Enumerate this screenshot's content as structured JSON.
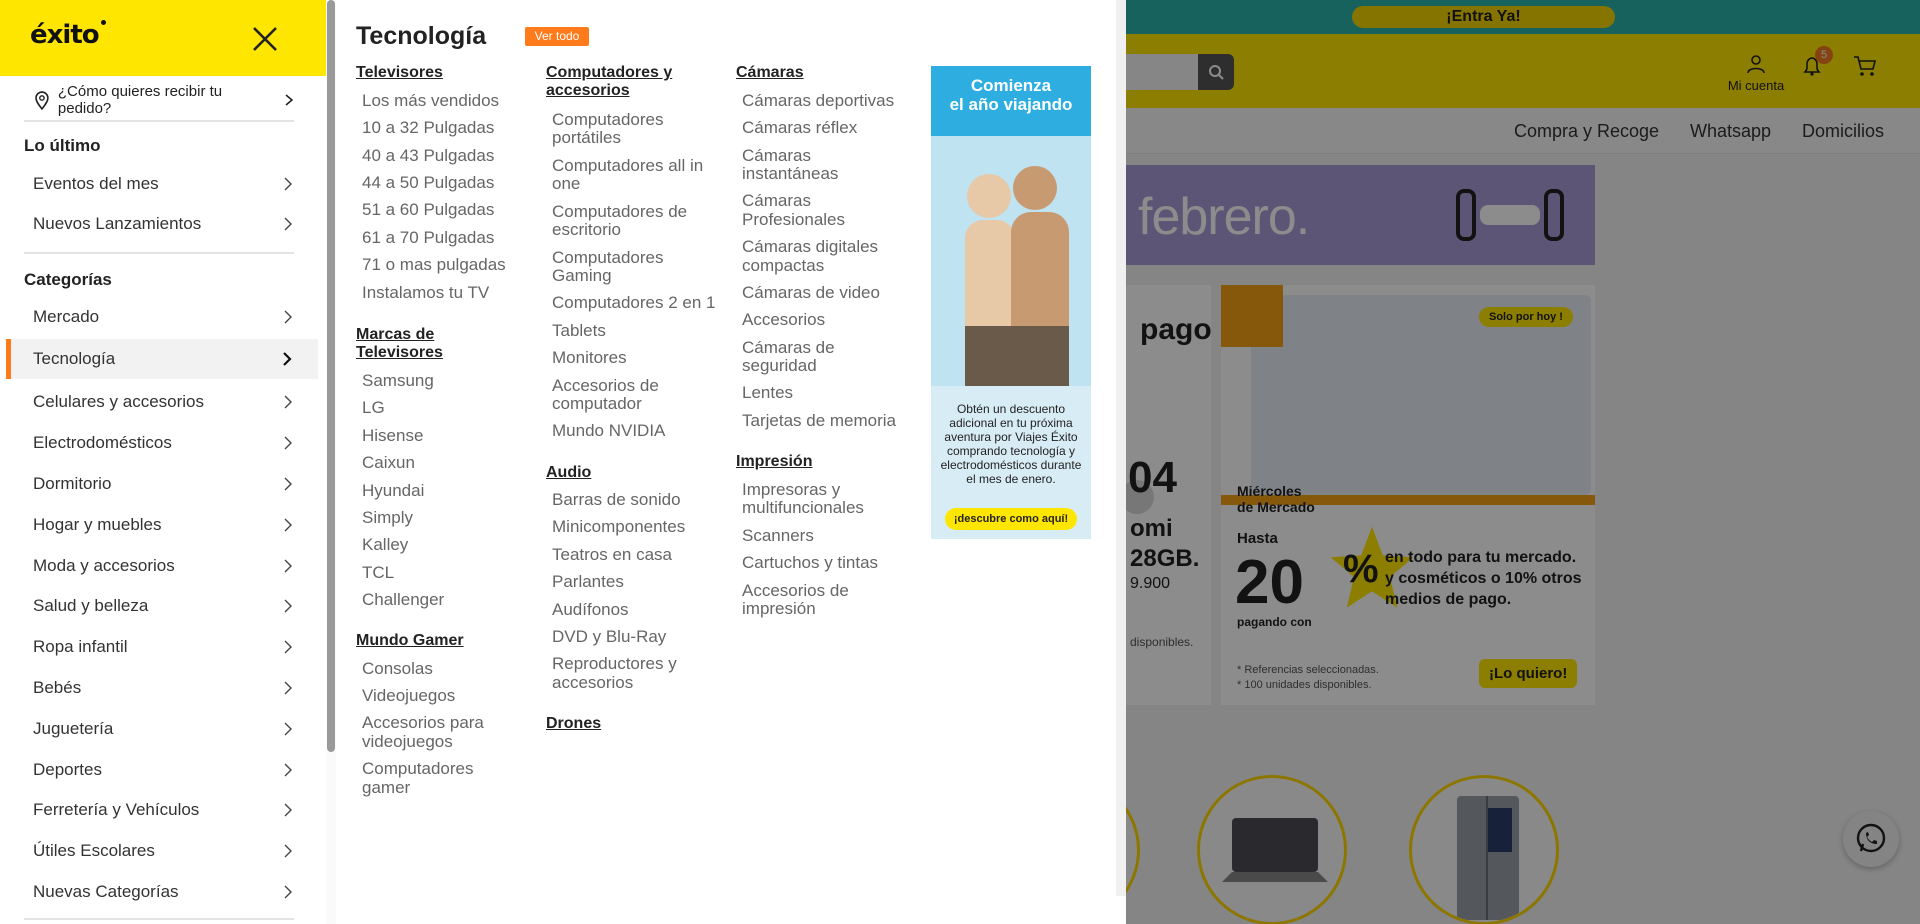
{
  "page": {
    "promo_button": "¡Entra Ya!",
    "account_label": "Mi cuenta",
    "notifications_count": "5",
    "nav_links": [
      "Compra y Recoge",
      "Whatsapp",
      "Domicilios"
    ],
    "banner_text": "febrero.",
    "card_left": {
      "title_fragment": "pago",
      "big_fragment": "04",
      "product_fragment": "omi",
      "storage_fragment": "28GB.",
      "price_fragment": "9.900",
      "note_fragment": "disponibles."
    },
    "card_right": {
      "badge": "Solo por hoy !",
      "title_line1": "Miércoles",
      "title_line2": "de Mercado",
      "hasta": "Hasta",
      "discount": "20",
      "percent": "%",
      "description": "en todo para tu mercado. y cosméticos o 10% otros medios de pago.",
      "pagando": "pagando con",
      "refs_line1": "* Referencias seleccionadas.",
      "refs_line2": "* 100 unidades disponibles.",
      "cta": "¡Lo quiero!"
    },
    "colors": {
      "brand_yellow": "#ffe600",
      "accent_orange": "#ff7a1a",
      "teal": "#2bb3a9"
    }
  },
  "drawer": {
    "logo": "éxito",
    "delivery_prompt": "¿Cómo quieres recibir tu pedido?",
    "section_latest": "Lo último",
    "latest_items": [
      "Eventos del mes",
      "Nuevos Lanzamientos"
    ],
    "section_categories": "Categorías",
    "categories": [
      "Mercado",
      "Tecnología",
      "Celulares y accesorios",
      "Electrodomésticos",
      "Dormitorio",
      "Hogar y muebles",
      "Moda y accesorios",
      "Salud y belleza",
      "Ropa infantil",
      "Bebés",
      "Juguetería",
      "Deportes",
      "Ferretería y Vehículos",
      "Útiles Escolares",
      "Nuevas Categorías"
    ],
    "active_category": "Tecnología"
  },
  "menu": {
    "title": "Tecnología",
    "view_all": "Ver todo",
    "col1": {
      "televisores": {
        "title": "Televisores",
        "items": [
          "Los más vendidos",
          "10 a 32 Pulgadas",
          "40 a 43 Pulgadas",
          "44 a 50 Pulgadas",
          "51 a 60 Pulgadas",
          "61 a 70 Pulgadas",
          "71 o mas pulgadas",
          "Instalamos tu TV"
        ]
      },
      "marcas": {
        "title_line1": "Marcas de",
        "title_line2": "Televisores",
        "items": [
          "Samsung",
          "LG",
          "Hisense",
          "Caixun",
          "Hyundai",
          "Simply",
          "Kalley",
          "TCL",
          "Challenger"
        ]
      },
      "gamer": {
        "title": "Mundo Gamer",
        "items": [
          "Consolas",
          "Videojuegos",
          "Accesorios para",
          "videojuegos",
          "Computadores",
          "gamer"
        ]
      }
    },
    "col2": {
      "computadores": {
        "title_line1": "Computadores y",
        "title_line2": "accesorios",
        "items": [
          "Computadores",
          "portátiles",
          "Computadores all in",
          "one",
          "Computadores de",
          "escritorio",
          "Computadores",
          "Gaming",
          "Computadores 2 en 1",
          "Tablets",
          "Monitores",
          "Accesorios de",
          "computador",
          "Mundo NVIDIA"
        ]
      },
      "audio": {
        "title": "Audio",
        "items": [
          "Barras de sonido",
          "Minicomponentes",
          "Teatros en casa",
          "Parlantes",
          "Audífonos",
          "DVD y Blu-Ray",
          "Reproductores y",
          "accesorios"
        ]
      },
      "drones": {
        "title": "Drones"
      }
    },
    "col3": {
      "camaras": {
        "title": "Cámaras",
        "items": [
          "Cámaras deportivas",
          "Cámaras réflex",
          "Cámaras",
          "instantáneas",
          "Cámaras",
          "Profesionales",
          "Cámaras digitales",
          "compactas",
          "Cámaras de video",
          "Accesorios",
          "Cámaras de",
          "seguridad",
          "Lentes",
          "Tarjetas de memoria"
        ]
      },
      "impresion": {
        "title": "Impresión",
        "items": [
          "Impresoras y",
          "multifuncionales",
          "Scanners",
          "Cartuchos y tintas",
          "Accesorios de",
          "impresión"
        ]
      }
    },
    "ad": {
      "headline_line1": "Comienza",
      "headline_line2": "el año viajando",
      "body": "Obtén un descuento adicional en tu próxima aventura por Viajes Éxito comprando tecnología y electrodomésticos durante el mes de enero.",
      "cta": "¡descubre como aquí!"
    }
  }
}
